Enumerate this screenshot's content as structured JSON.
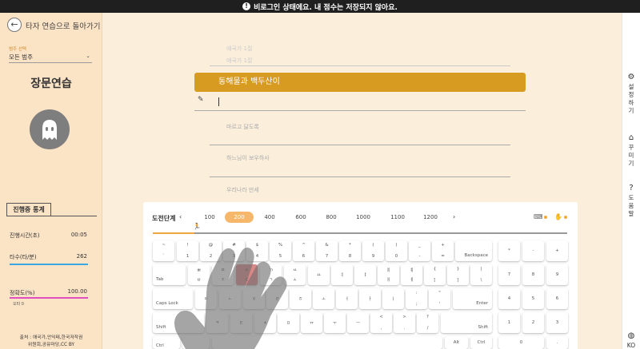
{
  "warning": {
    "text": "비로그인 상태에요. 내 점수는 저장되지 않아요."
  },
  "left": {
    "back_label": "타자 연습으로 돌아가기",
    "category_caption": "범주 선택",
    "category_value": "모든 범주",
    "mode_title": "장문연습",
    "stats_title": "진행중 통계",
    "elapsed_label": "진행시간(초)",
    "elapsed_value": "00:05",
    "speed_label": "타수(타/분)",
    "speed_value": "262",
    "accuracy_label": "정확도(%)",
    "accuracy_value": "100.00",
    "errors": "오타 0",
    "source_line1": "출처 : 애국가,안익태,한국저작권",
    "source_line2": "위원회,공유마당,CC BY"
  },
  "colors": {
    "accent": "#d89b22",
    "speed_bar": "#3aa7e0",
    "accuracy_bar": "#e04fbf",
    "progress": "#f0a83c"
  },
  "lines": {
    "prev1": "애국가 1절",
    "prev2": "애국가 1절",
    "current": "동해물과 백두산이",
    "next1": "마르고 닳도록",
    "next2": "하느님이 보우하사",
    "next3": "우리나라 만세"
  },
  "right": {
    "settings": [
      "설",
      "정",
      "하",
      "기"
    ],
    "decorate": [
      "꾸",
      "미",
      "기"
    ],
    "help": [
      "도",
      "움",
      "말"
    ],
    "lang": "KO"
  },
  "levels": {
    "label": "도전단계",
    "prev_arrow": "‹",
    "next_arrow": "›",
    "items": [
      "100",
      "200",
      "400",
      "600",
      "800",
      "1000",
      "1100",
      "1200"
    ],
    "selected": "200"
  },
  "keys": {
    "r1": [
      [
        "~",
        "`"
      ],
      [
        "!",
        "1"
      ],
      [
        "@",
        "2"
      ],
      [
        "#",
        "3"
      ],
      [
        "$",
        "4"
      ],
      [
        "%",
        "5"
      ],
      [
        "^",
        "6"
      ],
      [
        "&",
        "7"
      ],
      [
        "*",
        "8"
      ],
      [
        "(",
        "9"
      ],
      [
        ")",
        "0"
      ],
      [
        "_",
        "-"
      ],
      [
        "+",
        "="
      ]
    ],
    "backspace": "Backspace",
    "tab": "Tab",
    "r2": [
      [
        "ㅃ",
        "ㅂ"
      ],
      [
        "ㅉ",
        "ㅈ"
      ],
      [
        "ㄸ",
        "ㄷ"
      ],
      [
        "ㄲ",
        "ㄱ"
      ],
      [
        "ㅆ",
        "ㅅ"
      ],
      [
        "",
        "ㅛ"
      ],
      [
        "",
        "ㅕ"
      ],
      [
        "",
        "ㅑ"
      ],
      [
        "ㅒ",
        "ㅐ"
      ],
      [
        "ㅖ",
        "ㅔ"
      ],
      [
        "{",
        "["
      ],
      [
        "}",
        "]"
      ],
      [
        "|",
        "\\"
      ]
    ],
    "caps": "Caps Lock",
    "r3": [
      "ㅁ",
      "ㄴ",
      "ㅇ",
      "ㄹ",
      "ㅎ",
      "ㅗ",
      "ㅓ",
      "ㅏ",
      "ㅣ"
    ],
    "r3b": [
      [
        ":",
        ";"
      ],
      [
        "\"",
        "'"
      ]
    ],
    "enter": "Enter",
    "shift": "Shift",
    "r4": [
      "ㅋ",
      "ㅌ",
      "ㅊ",
      "ㅍ",
      "ㅠ",
      "ㅜ",
      "ㅡ"
    ],
    "r4b": [
      [
        "<",
        ","
      ],
      [
        ">",
        "."
      ],
      [
        "?",
        "/"
      ]
    ],
    "ctrl": "Ctrl",
    "alt": "Alt",
    "num_r1": [
      "*",
      "-",
      "+"
    ],
    "num_r2": [
      "7",
      "8",
      "9"
    ],
    "num_r3": [
      "4",
      "5",
      "6"
    ],
    "num_r4": [
      "1",
      "2",
      "3"
    ],
    "num_r5": [
      "0",
      "."
    ]
  }
}
